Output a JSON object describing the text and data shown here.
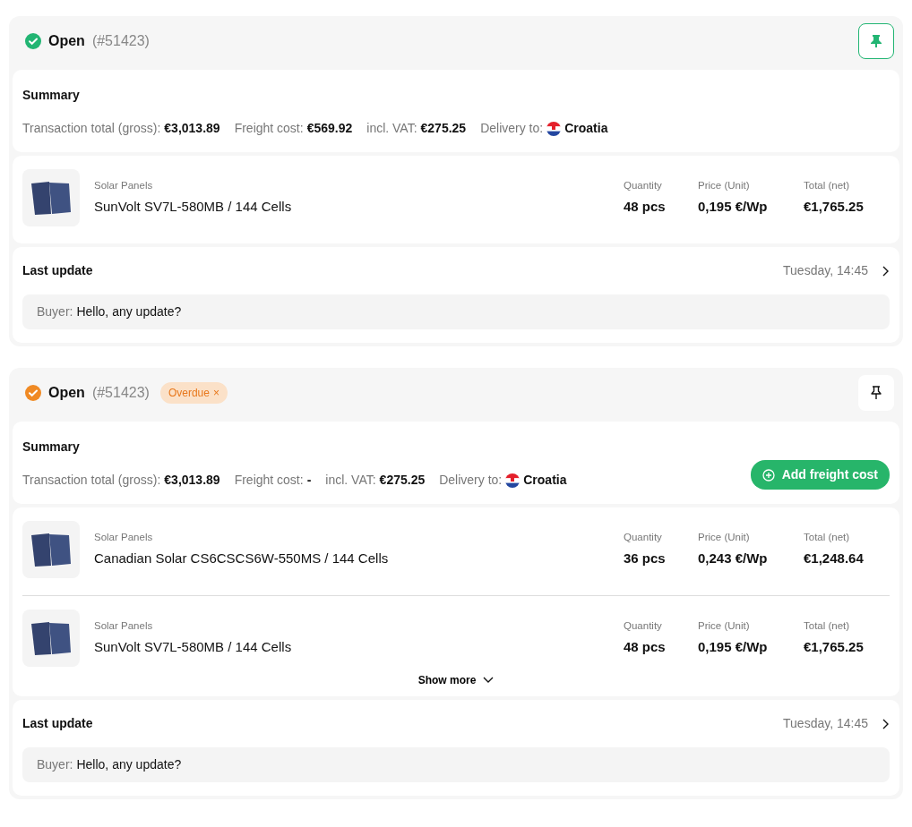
{
  "orders": [
    {
      "status": "Open",
      "number": "(#51423)",
      "color": "#22b573",
      "pinned": true,
      "summary": {
        "title": "Summary",
        "fields": [
          {
            "label": "Transaction total (gross):",
            "value": "€3,013.89"
          },
          {
            "label": "Freight cost:",
            "value": "€569.92"
          },
          {
            "label": "incl. VAT:",
            "value": "€275.25"
          },
          {
            "label": "Delivery to:",
            "value": "Croatia",
            "kind": "flag"
          }
        ]
      },
      "items": [
        {
          "category": "Solar Panels",
          "name": "SunVolt SV7L-580MB / 144 Cells",
          "columns": [
            {
              "label": "Quantity",
              "value": "48 pcs"
            },
            {
              "label": "Price (Unit)",
              "value": "0,195 €/Wp"
            },
            {
              "label": "Total (net)",
              "value": "€1,765.25"
            }
          ]
        }
      ],
      "last_update": {
        "title": "Last update",
        "time": "Tuesday, 14:45",
        "sender": "Buyer:",
        "message": "Hello, any update?"
      }
    },
    {
      "status": "Open",
      "number": "(#51423)",
      "color": "#f08a24",
      "pinned": false,
      "badge": {
        "label": "Overdue",
        "close": "×"
      },
      "summary": {
        "title": "Summary",
        "fields": [
          {
            "label": "Transaction total (gross):",
            "value": "€3,013.89"
          },
          {
            "label": "Freight cost:",
            "value": "-"
          },
          {
            "label": "incl. VAT:",
            "value": "€275.25"
          },
          {
            "label": "Delivery to:",
            "value": "Croatia",
            "kind": "flag"
          }
        ],
        "action": "Add freight cost"
      },
      "items": [
        {
          "category": "Solar Panels",
          "name": "Canadian Solar CS6CSCS6W-550MS / 144 Cells",
          "columns": [
            {
              "label": "Quantity",
              "value": "36 pcs"
            },
            {
              "label": "Price (Unit)",
              "value": "0,243 €/Wp"
            },
            {
              "label": "Total (net)",
              "value": "€1,248.64"
            }
          ]
        },
        {
          "category": "Solar Panels",
          "name": "SunVolt SV7L-580MB / 144 Cells",
          "columns": [
            {
              "label": "Quantity",
              "value": "48 pcs"
            },
            {
              "label": "Price (Unit)",
              "value": "0,195 €/Wp"
            },
            {
              "label": "Total (net)",
              "value": "€1,765.25"
            }
          ]
        }
      ],
      "show_more": "Show more",
      "last_update": {
        "title": "Last update",
        "time": "Tuesday, 14:45",
        "sender": "Buyer:",
        "message": "Hello, any update?"
      }
    }
  ]
}
